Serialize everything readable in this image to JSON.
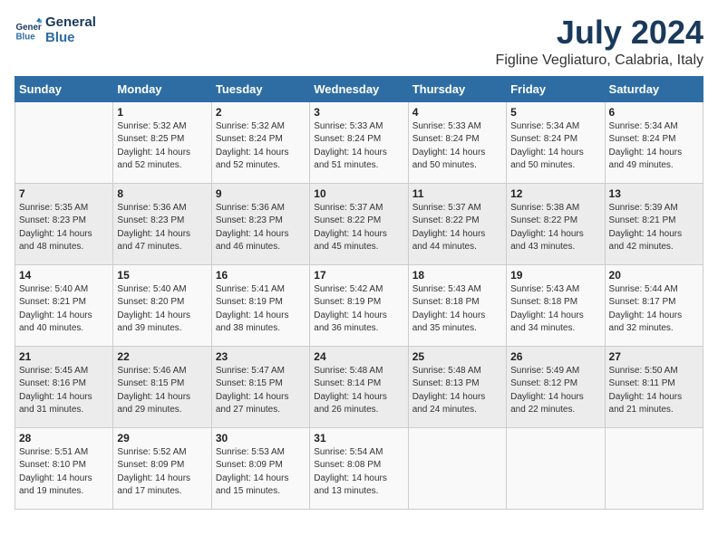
{
  "logo": {
    "line1": "General",
    "line2": "Blue"
  },
  "title": "July 2024",
  "subtitle": "Figline Vegliaturo, Calabria, Italy",
  "weekdays": [
    "Sunday",
    "Monday",
    "Tuesday",
    "Wednesday",
    "Thursday",
    "Friday",
    "Saturday"
  ],
  "weeks": [
    [
      {
        "day": "",
        "info": ""
      },
      {
        "day": "1",
        "info": "Sunrise: 5:32 AM\nSunset: 8:25 PM\nDaylight: 14 hours\nand 52 minutes."
      },
      {
        "day": "2",
        "info": "Sunrise: 5:32 AM\nSunset: 8:24 PM\nDaylight: 14 hours\nand 52 minutes."
      },
      {
        "day": "3",
        "info": "Sunrise: 5:33 AM\nSunset: 8:24 PM\nDaylight: 14 hours\nand 51 minutes."
      },
      {
        "day": "4",
        "info": "Sunrise: 5:33 AM\nSunset: 8:24 PM\nDaylight: 14 hours\nand 50 minutes."
      },
      {
        "day": "5",
        "info": "Sunrise: 5:34 AM\nSunset: 8:24 PM\nDaylight: 14 hours\nand 50 minutes."
      },
      {
        "day": "6",
        "info": "Sunrise: 5:34 AM\nSunset: 8:24 PM\nDaylight: 14 hours\nand 49 minutes."
      }
    ],
    [
      {
        "day": "7",
        "info": "Sunrise: 5:35 AM\nSunset: 8:23 PM\nDaylight: 14 hours\nand 48 minutes."
      },
      {
        "day": "8",
        "info": "Sunrise: 5:36 AM\nSunset: 8:23 PM\nDaylight: 14 hours\nand 47 minutes."
      },
      {
        "day": "9",
        "info": "Sunrise: 5:36 AM\nSunset: 8:23 PM\nDaylight: 14 hours\nand 46 minutes."
      },
      {
        "day": "10",
        "info": "Sunrise: 5:37 AM\nSunset: 8:22 PM\nDaylight: 14 hours\nand 45 minutes."
      },
      {
        "day": "11",
        "info": "Sunrise: 5:37 AM\nSunset: 8:22 PM\nDaylight: 14 hours\nand 44 minutes."
      },
      {
        "day": "12",
        "info": "Sunrise: 5:38 AM\nSunset: 8:22 PM\nDaylight: 14 hours\nand 43 minutes."
      },
      {
        "day": "13",
        "info": "Sunrise: 5:39 AM\nSunset: 8:21 PM\nDaylight: 14 hours\nand 42 minutes."
      }
    ],
    [
      {
        "day": "14",
        "info": "Sunrise: 5:40 AM\nSunset: 8:21 PM\nDaylight: 14 hours\nand 40 minutes."
      },
      {
        "day": "15",
        "info": "Sunrise: 5:40 AM\nSunset: 8:20 PM\nDaylight: 14 hours\nand 39 minutes."
      },
      {
        "day": "16",
        "info": "Sunrise: 5:41 AM\nSunset: 8:19 PM\nDaylight: 14 hours\nand 38 minutes."
      },
      {
        "day": "17",
        "info": "Sunrise: 5:42 AM\nSunset: 8:19 PM\nDaylight: 14 hours\nand 36 minutes."
      },
      {
        "day": "18",
        "info": "Sunrise: 5:43 AM\nSunset: 8:18 PM\nDaylight: 14 hours\nand 35 minutes."
      },
      {
        "day": "19",
        "info": "Sunrise: 5:43 AM\nSunset: 8:18 PM\nDaylight: 14 hours\nand 34 minutes."
      },
      {
        "day": "20",
        "info": "Sunrise: 5:44 AM\nSunset: 8:17 PM\nDaylight: 14 hours\nand 32 minutes."
      }
    ],
    [
      {
        "day": "21",
        "info": "Sunrise: 5:45 AM\nSunset: 8:16 PM\nDaylight: 14 hours\nand 31 minutes."
      },
      {
        "day": "22",
        "info": "Sunrise: 5:46 AM\nSunset: 8:15 PM\nDaylight: 14 hours\nand 29 minutes."
      },
      {
        "day": "23",
        "info": "Sunrise: 5:47 AM\nSunset: 8:15 PM\nDaylight: 14 hours\nand 27 minutes."
      },
      {
        "day": "24",
        "info": "Sunrise: 5:48 AM\nSunset: 8:14 PM\nDaylight: 14 hours\nand 26 minutes."
      },
      {
        "day": "25",
        "info": "Sunrise: 5:48 AM\nSunset: 8:13 PM\nDaylight: 14 hours\nand 24 minutes."
      },
      {
        "day": "26",
        "info": "Sunrise: 5:49 AM\nSunset: 8:12 PM\nDaylight: 14 hours\nand 22 minutes."
      },
      {
        "day": "27",
        "info": "Sunrise: 5:50 AM\nSunset: 8:11 PM\nDaylight: 14 hours\nand 21 minutes."
      }
    ],
    [
      {
        "day": "28",
        "info": "Sunrise: 5:51 AM\nSunset: 8:10 PM\nDaylight: 14 hours\nand 19 minutes."
      },
      {
        "day": "29",
        "info": "Sunrise: 5:52 AM\nSunset: 8:09 PM\nDaylight: 14 hours\nand 17 minutes."
      },
      {
        "day": "30",
        "info": "Sunrise: 5:53 AM\nSunset: 8:09 PM\nDaylight: 14 hours\nand 15 minutes."
      },
      {
        "day": "31",
        "info": "Sunrise: 5:54 AM\nSunset: 8:08 PM\nDaylight: 14 hours\nand 13 minutes."
      },
      {
        "day": "",
        "info": ""
      },
      {
        "day": "",
        "info": ""
      },
      {
        "day": "",
        "info": ""
      }
    ]
  ]
}
